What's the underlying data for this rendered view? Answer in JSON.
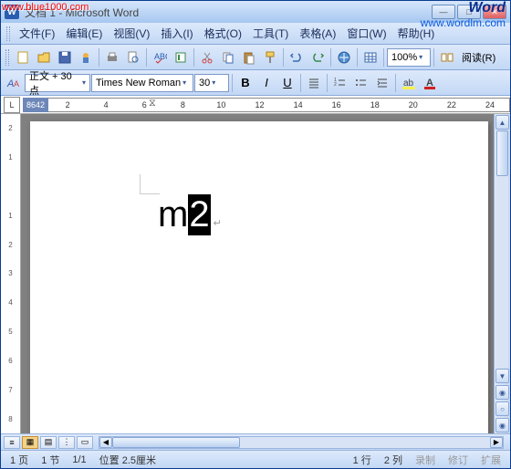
{
  "watermarks": {
    "tl": "www.blue1000.com",
    "tr": "Word",
    "tr2": "www.wordlm.com"
  },
  "titlebar": {
    "title": "文档 1 - Microsoft Word"
  },
  "menu": {
    "file": "文件(F)",
    "edit": "编辑(E)",
    "view": "视图(V)",
    "insert": "插入(I)",
    "format": "格式(O)",
    "tools": "工具(T)",
    "table": "表格(A)",
    "window": "窗口(W)",
    "help": "帮助(H)"
  },
  "toolbar": {
    "zoom": "100%",
    "read": "阅读(R)"
  },
  "format": {
    "style": "正文 + 30 点",
    "font": "Times New Roman",
    "size": "30",
    "bold": "B",
    "italic": "I",
    "underline": "U"
  },
  "ruler": {
    "neg": [
      "8",
      "6",
      "4",
      "2"
    ],
    "pos": [
      "2",
      "4",
      "6",
      "8",
      "10",
      "12",
      "14",
      "16",
      "18",
      "20",
      "22",
      "24"
    ]
  },
  "vruler": [
    "2",
    "1",
    "",
    "1",
    "2",
    "3",
    "4",
    "5",
    "6",
    "7",
    "8"
  ],
  "document": {
    "text_before": "m",
    "text_selected": "2",
    "para_mark": "↵"
  },
  "status": {
    "page": "1 页",
    "section": "1 节",
    "pages": "1/1",
    "position": "位置 2.5厘米",
    "line": "1 行",
    "col": "2 列",
    "rec": "录制",
    "rev": "修订",
    "ext": "扩展"
  },
  "icons": {
    "min": "—",
    "max": "□",
    "close": "✕",
    "up": "▲",
    "down": "▼",
    "left": "◀",
    "right": "▶",
    "dd": "▾"
  }
}
